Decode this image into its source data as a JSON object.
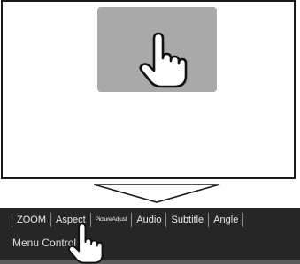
{
  "tabs": [
    {
      "label": "ZOOM"
    },
    {
      "label": "Aspect"
    },
    {
      "label": "PictureAdjust"
    },
    {
      "label": "Audio"
    },
    {
      "label": "Subtitle"
    },
    {
      "label": "Angle"
    }
  ],
  "menu_caption": "Menu Control",
  "icons": {
    "touch_hand": "pointing-hand-icon",
    "menu_hand": "pointing-hand-icon",
    "transition": "down-arrow-icon"
  },
  "colors": {
    "touch_area": "#a9a9a9",
    "menubar": "#262626",
    "frame": "#1a1a1a"
  }
}
